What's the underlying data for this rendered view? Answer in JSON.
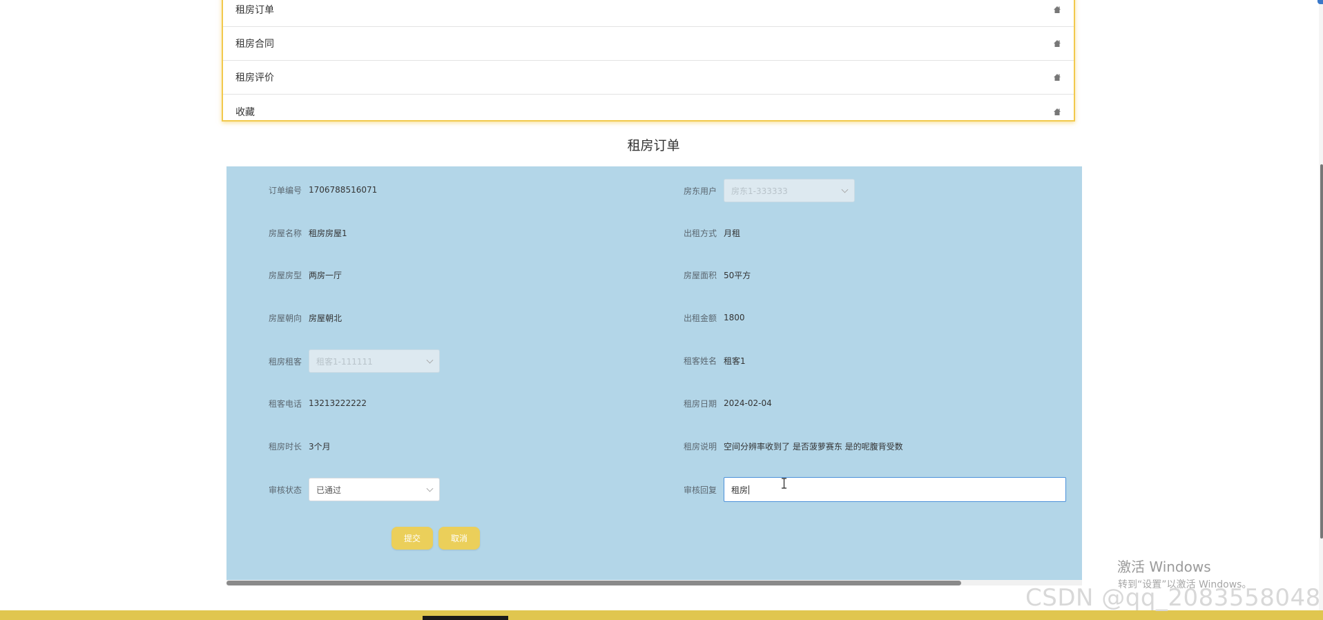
{
  "menu": {
    "items": [
      {
        "label": "租房订单",
        "icon": "home-icon"
      },
      {
        "label": "租房合同",
        "icon": "home-icon"
      },
      {
        "label": "租房评价",
        "icon": "home-icon"
      },
      {
        "label": "收藏",
        "icon": "home-icon"
      }
    ]
  },
  "page_title": "租房订单",
  "form": {
    "order_no": {
      "label": "订单编号",
      "value": "1706788516071"
    },
    "landlord": {
      "label": "房东用户",
      "value": "房东1-333333"
    },
    "house_name": {
      "label": "房屋名称",
      "value": "租房房屋1"
    },
    "rent_mode": {
      "label": "出租方式",
      "value": "月租"
    },
    "house_type": {
      "label": "房屋房型",
      "value": "两房一厅"
    },
    "house_area": {
      "label": "房屋面积",
      "value": "50平方"
    },
    "orientation": {
      "label": "房屋朝向",
      "value": "房屋朝北"
    },
    "rent_amount": {
      "label": "出租金额",
      "value": "1800"
    },
    "tenant": {
      "label": "租房租客",
      "value": "租客1-111111"
    },
    "tenant_name": {
      "label": "租客姓名",
      "value": "租客1"
    },
    "tenant_phone": {
      "label": "租客电话",
      "value": "13213222222"
    },
    "rent_date": {
      "label": "租房日期",
      "value": "2024-02-04"
    },
    "duration": {
      "label": "租房时长",
      "value": "3个月"
    },
    "description": {
      "label": "租房说明",
      "value": "空间分辨率收到了 是否菠萝赛东 是的呢腹背受数"
    },
    "audit_status": {
      "label": "审核状态",
      "value": "已通过"
    },
    "audit_reply": {
      "label": "审核回复",
      "value": "租房"
    }
  },
  "buttons": {
    "submit": "提交",
    "cancel": "取消"
  },
  "watermark": {
    "title": "激活 Windows",
    "subtitle": "转到“设置”以激活 Windows。",
    "csdn": "CSDN @qq_2083558048"
  },
  "colors": {
    "panel_bg": "#b3d6e8",
    "accent_yellow": "#ebcf5a",
    "menu_border": "#f2c94c",
    "input_focus": "#4a90d9"
  }
}
